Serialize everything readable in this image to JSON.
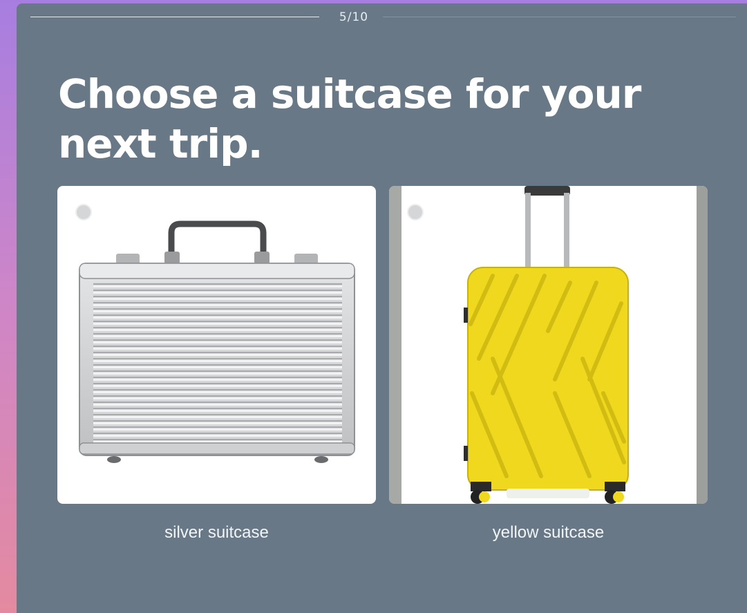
{
  "progress": {
    "counter": "5/10",
    "current": 5,
    "total": 10
  },
  "question": {
    "title": "Choose a suitcase for your next trip."
  },
  "options": [
    {
      "label": "silver suitcase",
      "image_icon": "silver-briefcase-image",
      "selected": false
    },
    {
      "label": "yellow suitcase",
      "image_icon": "yellow-rolling-suitcase-image",
      "selected": false
    }
  ],
  "colors": {
    "panel": "#687887",
    "text": "#ffffff",
    "gradient_top": "#a77ee0",
    "gradient_bottom": "#e48aa0",
    "suitcase_yellow": "#f2dc1f",
    "suitcase_silver": "#c9cacc"
  }
}
